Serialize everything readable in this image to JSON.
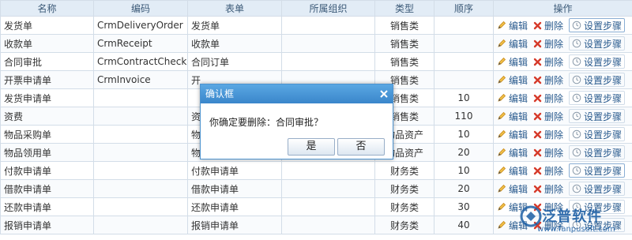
{
  "table": {
    "headers": [
      "名称",
      "编码",
      "表单",
      "所属组织",
      "类型",
      "顺序",
      "操作"
    ],
    "rows": [
      {
        "name": "发货单",
        "code": "CrmDeliveryOrder",
        "form": "发货单",
        "org": "",
        "type": "销售类",
        "order": ""
      },
      {
        "name": "收款单",
        "code": "CrmReceipt",
        "form": "收款单",
        "org": "",
        "type": "销售类",
        "order": ""
      },
      {
        "name": "合同审批",
        "code": "CrmContractCheck",
        "form": "合同订单",
        "org": "",
        "type": "销售类",
        "order": ""
      },
      {
        "name": "开票申请单",
        "code": "CrmInvoice",
        "form": "开",
        "org": "",
        "type": "销售类",
        "order": ""
      },
      {
        "name": "发货申请单",
        "code": "",
        "form": "",
        "org": "",
        "type": "销售类",
        "order": "10"
      },
      {
        "name": "资费",
        "code": "",
        "form": "资",
        "org": "",
        "type": "销售类",
        "order": "110"
      },
      {
        "name": "物品采购单",
        "code": "",
        "form": "物",
        "org": "",
        "type": "物品资产",
        "order": "10"
      },
      {
        "name": "物品领用单",
        "code": "",
        "form": "物品出库单",
        "org": "",
        "type": "物品资产",
        "order": "20"
      },
      {
        "name": "付款申请单",
        "code": "",
        "form": "付款申请单",
        "org": "",
        "type": "财务类",
        "order": "10"
      },
      {
        "name": "借款申请单",
        "code": "",
        "form": "借款申请单",
        "org": "",
        "type": "财务类",
        "order": "20"
      },
      {
        "name": "还款申请单",
        "code": "",
        "form": "还款申请单",
        "org": "",
        "type": "财务类",
        "order": "30"
      },
      {
        "name": "报销申请单",
        "code": "",
        "form": "报销申请单",
        "org": "",
        "type": "财务类",
        "order": "40"
      }
    ],
    "actions": {
      "edit": "编辑",
      "delete": "删除",
      "steps": "设置步骤"
    }
  },
  "dialog": {
    "title": "确认框",
    "message": "你确定要删除：合同审批？",
    "yes": "是",
    "no": "否"
  },
  "watermark": {
    "brand": "泛普软件",
    "url": "www.fanpusoft.com"
  },
  "colors": {
    "header_bg": "#e2ecf6",
    "link": "#2a5b8e",
    "dialog_title": "#3a86cb",
    "delete_red": "#d63a2a",
    "edit_yellow": "#e8b63a"
  }
}
